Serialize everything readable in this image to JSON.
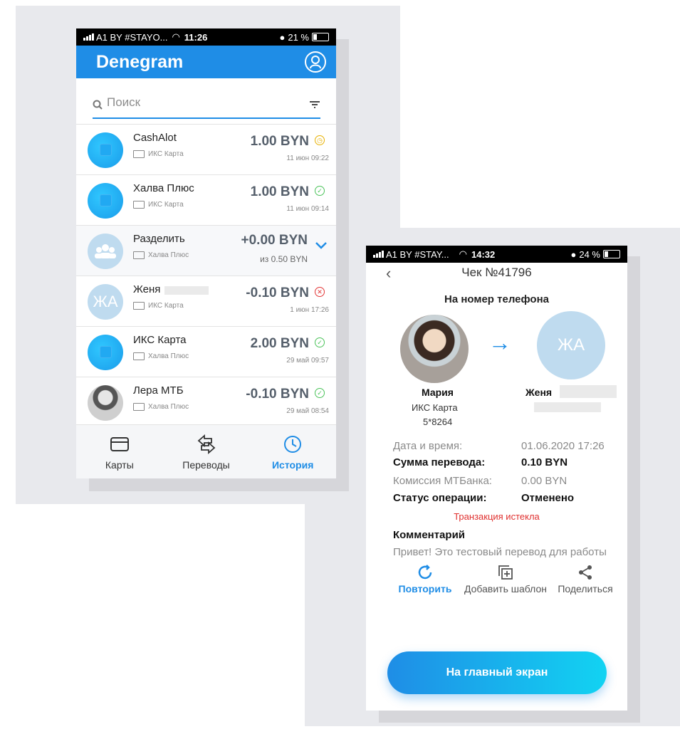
{
  "phone1": {
    "status": {
      "carrier": "A1 BY #STAYO...",
      "time": "11:26",
      "battery": "21 %"
    },
    "app_title": "Denegram",
    "search": {
      "placeholder": "Поиск"
    },
    "transactions": [
      {
        "name": "CashAlot",
        "source": "ИКС Карта",
        "amount": "1.00 BYN",
        "date": "11 июн 09:22",
        "status": "pending"
      },
      {
        "name": "Халва Плюс",
        "source": "ИКС Карта",
        "amount": "1.00 BYN",
        "date": "11 июн 09:14",
        "status": "success"
      },
      {
        "name": "Разделить",
        "source": "Халва Плюс",
        "amount": "+0.00 BYN",
        "date": "из 0.50 BYN",
        "status": "expand"
      },
      {
        "name": "Женя",
        "source": "ИКС Карта",
        "amount": "-0.10 BYN",
        "date": "1 июн 17:26",
        "status": "failed",
        "avatar_text": "ЖА"
      },
      {
        "name": "ИКС Карта",
        "source": "Халва Плюс",
        "amount": "2.00 BYN",
        "date": "29 май 09:57",
        "status": "success"
      },
      {
        "name": "Лера МТБ",
        "source": "Халва Плюс",
        "amount": "-0.10 BYN",
        "date": "29 май 08:54",
        "status": "success"
      }
    ],
    "nav": [
      {
        "label": "Карты",
        "icon": "card-icon"
      },
      {
        "label": "Переводы",
        "icon": "transfer-icon"
      },
      {
        "label": "История",
        "icon": "clock-icon"
      }
    ]
  },
  "phone2": {
    "status": {
      "carrier": "A1 BY #STAY...",
      "time": "14:32",
      "battery": "24 %"
    },
    "title": "Чек №41796",
    "subtitle": "На номер телефона",
    "sender": {
      "name": "Мария",
      "card": "ИКС Карта",
      "card_number": "5*8264"
    },
    "receiver": {
      "name": "Женя",
      "initials": "ЖА"
    },
    "details": [
      {
        "label": "Дата и время:",
        "value": "01.06.2020 17:26"
      },
      {
        "label": "Сумма перевода:",
        "value": "0.10 BYN"
      },
      {
        "label": "Комиссия МТБанка:",
        "value": "0.00 BYN"
      },
      {
        "label": "Статус операции:",
        "value": "Отменено"
      }
    ],
    "expired_note": "Транзакция истекла",
    "comment_label": "Комментарий",
    "comment_text": "Привет! Это тестовый перевод для работы",
    "actions": [
      {
        "label": "Повторить",
        "icon": "repeat-icon"
      },
      {
        "label": "Добавить шаблон",
        "icon": "add-template-icon"
      },
      {
        "label": "Поделиться",
        "icon": "share-icon"
      }
    ],
    "main_button": "На главный экран"
  },
  "colors": {
    "primary": "#1f8de6",
    "success": "#4bc35a",
    "pending": "#e8b100",
    "error": "#e0302f"
  }
}
